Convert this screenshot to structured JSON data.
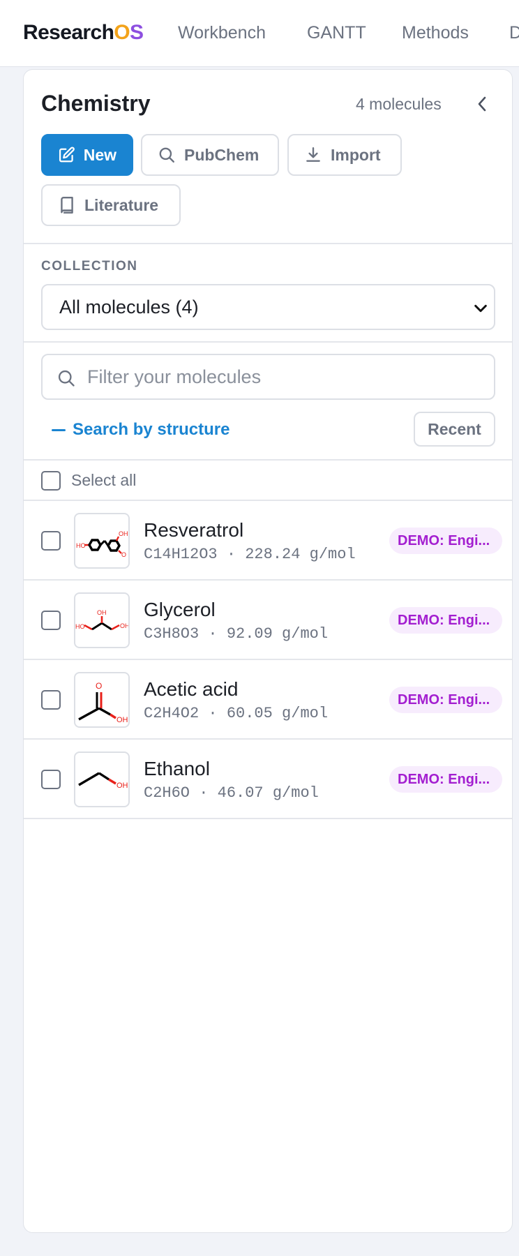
{
  "app": {
    "brand_part1": "Research",
    "brand_part2": "O",
    "brand_part3": "S",
    "brand_colors": {
      "dark": "#141821",
      "o": "#f3a31a",
      "s": "#8d4fe0"
    },
    "nav": [
      "Workbench",
      "GANTT",
      "Methods",
      "D"
    ]
  },
  "panel": {
    "title": "Chemistry",
    "count": "4 molecules",
    "collapse_icon": "chevron-left-icon",
    "buttons": {
      "new": "New",
      "pubchem": "PubChem",
      "import": "Import",
      "literature": "Literature"
    },
    "collection_label": "COLLECTION",
    "collection_value": "All molecules (4)",
    "filter_placeholder": "Filter your molecules",
    "structure_search": "Search by structure",
    "recent": "Recent",
    "select_all": "Select all"
  },
  "molecules": [
    {
      "name": "Resveratrol",
      "formula": "C14H12O3",
      "mass": "228.24 g/mol",
      "tag": "DEMO: Engi..."
    },
    {
      "name": "Glycerol",
      "formula": "C3H8O3",
      "mass": "92.09 g/mol",
      "tag": "DEMO: Engi..."
    },
    {
      "name": "Acetic acid",
      "formula": "C2H4O2",
      "mass": "60.05 g/mol",
      "tag": "DEMO: Engi..."
    },
    {
      "name": "Ethanol",
      "formula": "C2H6O",
      "mass": "46.07 g/mol",
      "tag": "DEMO: Engi..."
    }
  ],
  "colors": {
    "accent": "#1a84d1",
    "tag_text": "#a31ed0",
    "tag_bg": "#f7ecfd",
    "oxygen": "#e8201a"
  }
}
